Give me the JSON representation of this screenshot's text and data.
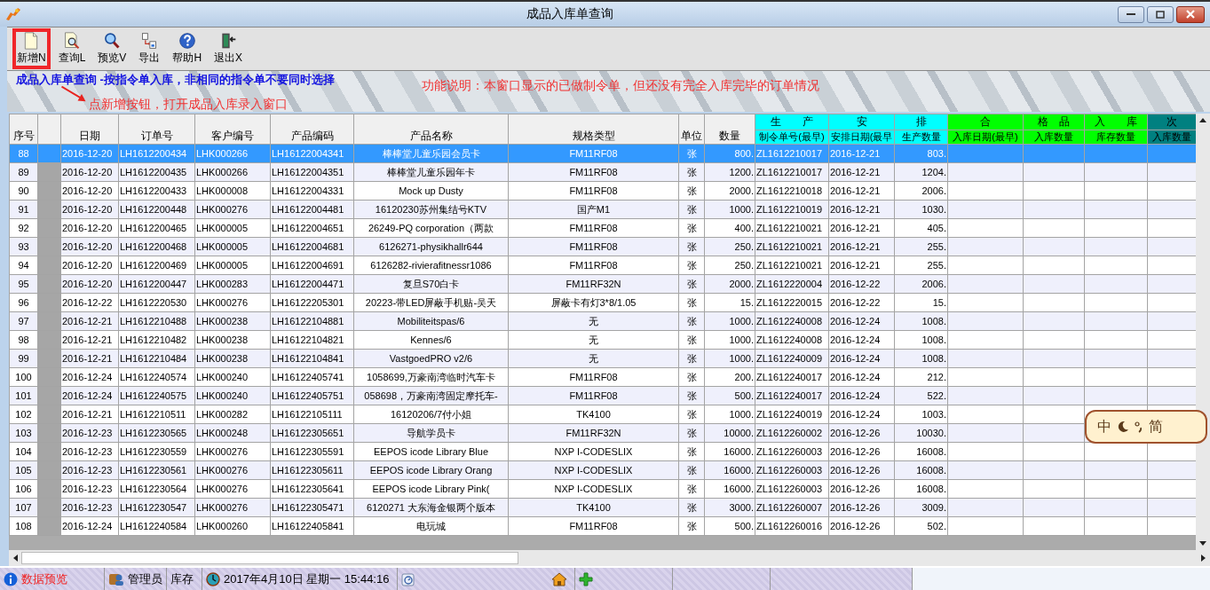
{
  "window": {
    "title": "成品入库单查询"
  },
  "toolbar": [
    {
      "kind": "new",
      "label": "新增N",
      "highlighted": true
    },
    {
      "kind": "query",
      "label": "查询L",
      "highlighted": false
    },
    {
      "kind": "preview",
      "label": "预览V",
      "highlighted": false
    },
    {
      "kind": "export",
      "label": "导出",
      "highlighted": false
    },
    {
      "kind": "help",
      "label": "帮助H",
      "highlighted": false
    },
    {
      "kind": "exit",
      "label": "退出X",
      "highlighted": false
    }
  ],
  "banner": {
    "title": "成品入库单查询  -按指令单入库，非相同的指令单不要同时选择"
  },
  "annotations": {
    "button_hint": "点新增按钮，打开成品入库录入窗口",
    "description": "功能说明：本窗口显示的已做制令单，但还没有完全入库完毕的订单情况"
  },
  "table": {
    "columns": [
      {
        "label": "序号"
      },
      {
        "label": "日期"
      },
      {
        "label": "订单号"
      },
      {
        "label": "客户编号"
      },
      {
        "label": "产品编码"
      },
      {
        "label": "产品名称"
      },
      {
        "label": "规格类型"
      },
      {
        "label": "单位"
      },
      {
        "label": "数量"
      },
      {
        "group": "生　　产",
        "label": "制令单号(最早)",
        "color": "#00ffff"
      },
      {
        "group": "安",
        "label": "安排日期(最早",
        "color": "#00ffff"
      },
      {
        "group": "排",
        "label": "生产数量",
        "color": "#00ffff"
      },
      {
        "group": "合",
        "label": "入库日期(最早)",
        "color": "#00ff00"
      },
      {
        "group": "格　品",
        "label": "入库数量",
        "color": "#00ff00"
      },
      {
        "group": "入　　库",
        "label": "库存数量",
        "color": "#00ff00"
      },
      {
        "group": "次",
        "label": "入库数量",
        "color": "#008080"
      }
    ],
    "rows": [
      {
        "selected": true,
        "cells": [
          "88",
          "2016-12-20",
          "LH1612200434",
          "LHK000266",
          "LH16122004341",
          "棒棒堂儿童乐园会员卡",
          "FM11RF08",
          "张",
          "800.",
          "ZL1612210017",
          "2016-12-21",
          "803."
        ]
      },
      {
        "selected": false,
        "cells": [
          "89",
          "2016-12-20",
          "LH1612200435",
          "LHK000266",
          "LH16122004351",
          "棒棒堂儿童乐园年卡",
          "FM11RF08",
          "张",
          "1200.",
          "ZL1612210017",
          "2016-12-21",
          "1204."
        ]
      },
      {
        "selected": false,
        "cells": [
          "90",
          "2016-12-20",
          "LH1612200433",
          "LHK000008",
          "LH16122004331",
          "Mock up Dusty",
          "FM11RF08",
          "张",
          "2000.",
          "ZL1612210018",
          "2016-12-21",
          "2006."
        ]
      },
      {
        "selected": false,
        "cells": [
          "91",
          "2016-12-20",
          "LH1612200448",
          "LHK000276",
          "LH16122004481",
          "16120230苏州集结号KTV",
          "国产M1",
          "张",
          "1000.",
          "ZL1612210019",
          "2016-12-21",
          "1030."
        ]
      },
      {
        "selected": false,
        "cells": [
          "92",
          "2016-12-20",
          "LH1612200465",
          "LHK000005",
          "LH16122004651",
          "26249-PQ corporation（两款",
          "FM11RF08",
          "张",
          "400.",
          "ZL1612210021",
          "2016-12-21",
          "405."
        ]
      },
      {
        "selected": false,
        "cells": [
          "93",
          "2016-12-20",
          "LH1612200468",
          "LHK000005",
          "LH16122004681",
          "6126271-physikhallr644",
          "FM11RF08",
          "张",
          "250.",
          "ZL1612210021",
          "2016-12-21",
          "255."
        ]
      },
      {
        "selected": false,
        "cells": [
          "94",
          "2016-12-20",
          "LH1612200469",
          "LHK000005",
          "LH16122004691",
          "6126282-rivierafitnessr1086",
          "FM11RF08",
          "张",
          "250.",
          "ZL1612210021",
          "2016-12-21",
          "255."
        ]
      },
      {
        "selected": false,
        "cells": [
          "95",
          "2016-12-20",
          "LH1612200447",
          "LHK000283",
          "LH16122004471",
          "复旦S70白卡",
          "FM11RF32N",
          "张",
          "2000.",
          "ZL1612220004",
          "2016-12-22",
          "2006."
        ]
      },
      {
        "selected": false,
        "cells": [
          "96",
          "2016-12-22",
          "LH1612220530",
          "LHK000276",
          "LH16122205301",
          "20223-带LED屏蔽手机贴-吴天",
          "屏蔽卡有灯3*8/1.05",
          "张",
          "15.",
          "ZL1612220015",
          "2016-12-22",
          "15."
        ]
      },
      {
        "selected": false,
        "cells": [
          "97",
          "2016-12-21",
          "LH1612210488",
          "LHK000238",
          "LH16122104881",
          "Mobiliteitspas/6",
          "无",
          "张",
          "1000.",
          "ZL1612240008",
          "2016-12-24",
          "1008."
        ]
      },
      {
        "selected": false,
        "cells": [
          "98",
          "2016-12-21",
          "LH1612210482",
          "LHK000238",
          "LH16122104821",
          "Kennes/6",
          "无",
          "张",
          "1000.",
          "ZL1612240008",
          "2016-12-24",
          "1008."
        ]
      },
      {
        "selected": false,
        "cells": [
          "99",
          "2016-12-21",
          "LH1612210484",
          "LHK000238",
          "LH16122104841",
          "VastgoedPRO v2/6",
          "无",
          "张",
          "1000.",
          "ZL1612240009",
          "2016-12-24",
          "1008."
        ]
      },
      {
        "selected": false,
        "cells": [
          "100",
          "2016-12-24",
          "LH1612240574",
          "LHK000240",
          "LH16122405741",
          "1058699,万豪南湾临时汽车卡",
          "FM11RF08",
          "张",
          "200.",
          "ZL1612240017",
          "2016-12-24",
          "212."
        ]
      },
      {
        "selected": false,
        "cells": [
          "101",
          "2016-12-24",
          "LH1612240575",
          "LHK000240",
          "LH16122405751",
          "058698，万豪南湾固定摩托车-",
          "FM11RF08",
          "张",
          "500.",
          "ZL1612240017",
          "2016-12-24",
          "522."
        ]
      },
      {
        "selected": false,
        "cells": [
          "102",
          "2016-12-21",
          "LH1612210511",
          "LHK000282",
          "LH16122105111",
          "16120206/7付小姐",
          "TK4100",
          "张",
          "1000.",
          "ZL1612240019",
          "2016-12-24",
          "1003."
        ]
      },
      {
        "selected": false,
        "cells": [
          "103",
          "2016-12-23",
          "LH1612230565",
          "LHK000248",
          "LH16122305651",
          "导航学员卡",
          "FM11RF32N",
          "张",
          "10000.",
          "ZL1612260002",
          "2016-12-26",
          "10030."
        ]
      },
      {
        "selected": false,
        "cells": [
          "104",
          "2016-12-23",
          "LH1612230559",
          "LHK000276",
          "LH16122305591",
          "EEPOS icode Library Blue",
          "NXP I-CODESLIX",
          "张",
          "16000.",
          "ZL1612260003",
          "2016-12-26",
          "16008."
        ]
      },
      {
        "selected": false,
        "cells": [
          "105",
          "2016-12-23",
          "LH1612230561",
          "LHK000276",
          "LH16122305611",
          "EEPOS icode Library Orang",
          "NXP I-CODESLIX",
          "张",
          "16000.",
          "ZL1612260003",
          "2016-12-26",
          "16008."
        ]
      },
      {
        "selected": false,
        "cells": [
          "106",
          "2016-12-23",
          "LH1612230564",
          "LHK000276",
          "LH16122305641",
          "EEPOS icode Library Pink(",
          "NXP I-CODESLIX",
          "张",
          "16000.",
          "ZL1612260003",
          "2016-12-26",
          "16008."
        ]
      },
      {
        "selected": false,
        "cells": [
          "107",
          "2016-12-23",
          "LH1612230547",
          "LHK000276",
          "LH16122305471",
          "6120271 大东海金银两个版本",
          "TK4100",
          "张",
          "3000.",
          "ZL1612260007",
          "2016-12-26",
          "3009."
        ]
      },
      {
        "selected": false,
        "cells": [
          "108",
          "2016-12-24",
          "LH1612240584",
          "LHK000260",
          "LH16122405841",
          "电玩城",
          "FM11RF08",
          "张",
          "500.",
          "ZL1612260016",
          "2016-12-26",
          "502."
        ]
      }
    ]
  },
  "ime": {
    "language": "中",
    "script": "简"
  },
  "status_bar": {
    "mode": "数据预览",
    "user": "管理员",
    "module": "库存",
    "datetime": "2017年4月10日 星期一 15:44:16"
  }
}
